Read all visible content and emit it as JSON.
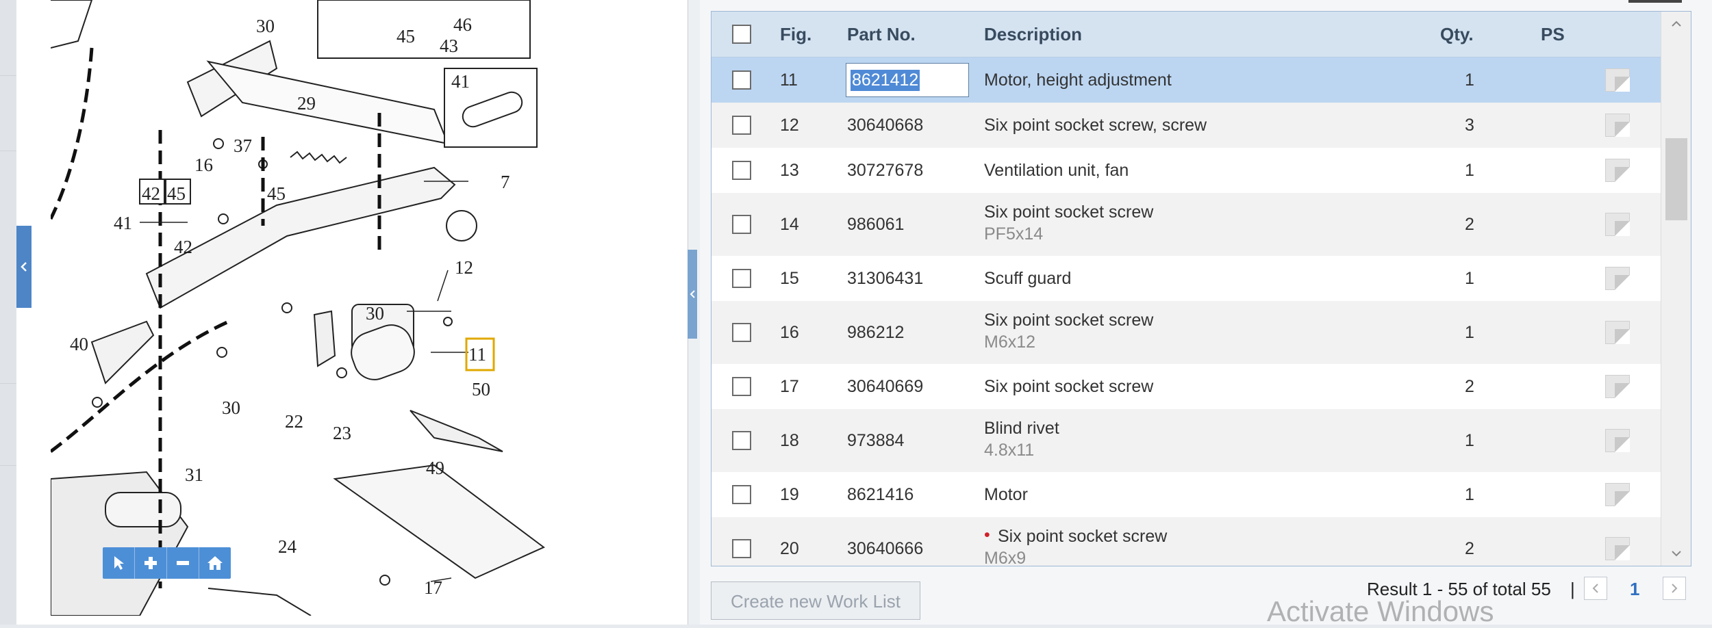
{
  "diagram": {
    "labels": [
      "30",
      "45",
      "46",
      "43",
      "41",
      "29",
      "7",
      "37",
      "16",
      "42",
      "45",
      "45",
      "41",
      "42",
      "12",
      "30",
      "11",
      "40",
      "50",
      "30",
      "22",
      "23",
      "31",
      "49",
      "24",
      "17"
    ]
  },
  "zoom_toolbar": {
    "icons": [
      "pointer-icon",
      "zoom-in-icon",
      "zoom-out-icon",
      "home-icon"
    ]
  },
  "table": {
    "headers": {
      "fig": "Fig.",
      "part_no": "Part No.",
      "description": "Description",
      "qty": "Qty.",
      "ps": "PS"
    },
    "rows": [
      {
        "fig": "11",
        "part_no": "8621412",
        "description": "Motor, height adjustment",
        "sub": "",
        "qty": "1",
        "selected": true,
        "bullet": false
      },
      {
        "fig": "12",
        "part_no": "30640668",
        "description": "Six point socket screw, screw",
        "sub": "",
        "qty": "3",
        "selected": false,
        "bullet": false
      },
      {
        "fig": "13",
        "part_no": "30727678",
        "description": "Ventilation unit, fan",
        "sub": "",
        "qty": "1",
        "selected": false,
        "bullet": false
      },
      {
        "fig": "14",
        "part_no": "986061",
        "description": "Six point socket screw",
        "sub": "PF5x14",
        "qty": "2",
        "selected": false,
        "bullet": false
      },
      {
        "fig": "15",
        "part_no": "31306431",
        "description": "Scuff guard",
        "sub": "",
        "qty": "1",
        "selected": false,
        "bullet": false
      },
      {
        "fig": "16",
        "part_no": "986212",
        "description": "Six point socket screw",
        "sub": "M6x12",
        "qty": "1",
        "selected": false,
        "bullet": false
      },
      {
        "fig": "17",
        "part_no": "30640669",
        "description": "Six point socket screw",
        "sub": "",
        "qty": "2",
        "selected": false,
        "bullet": false
      },
      {
        "fig": "18",
        "part_no": "973884",
        "description": "Blind rivet",
        "sub": "4.8x11",
        "qty": "1",
        "selected": false,
        "bullet": false
      },
      {
        "fig": "19",
        "part_no": "8621416",
        "description": "Motor",
        "sub": "",
        "qty": "1",
        "selected": false,
        "bullet": false
      },
      {
        "fig": "20",
        "part_no": "30640666",
        "description": "Six point socket screw",
        "sub": "M6x9",
        "qty": "2",
        "selected": false,
        "bullet": true
      }
    ]
  },
  "footer": {
    "create_work_list": "Create new Work List",
    "result_text": "Result 1 - 55 of total 55",
    "separator": "|",
    "page": "1"
  },
  "watermark": "Activate Windows",
  "colors": {
    "header_bg": "#d5e3f1",
    "selected_row": "#bcd6f2",
    "accent": "#4d8fd7"
  }
}
